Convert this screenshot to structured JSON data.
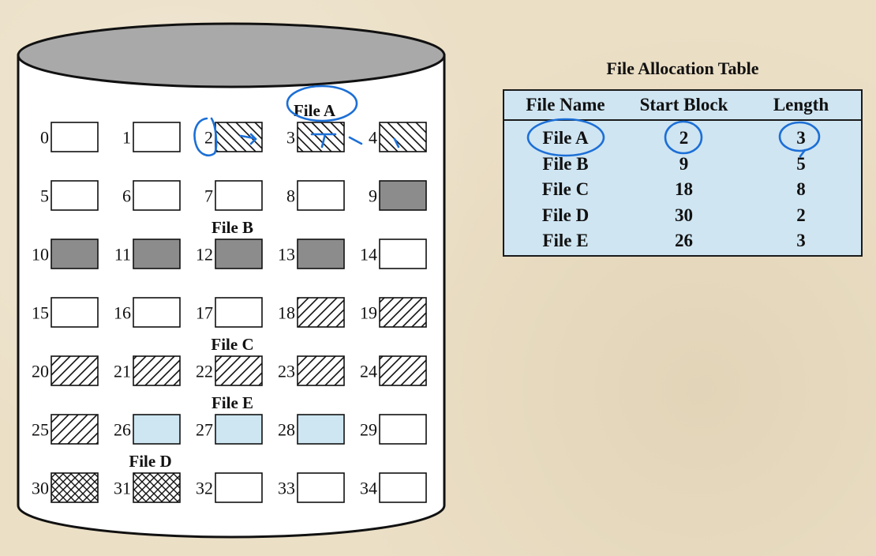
{
  "disk": {
    "blocks": [
      {
        "n": "0",
        "fill": "empty"
      },
      {
        "n": "1",
        "fill": "empty"
      },
      {
        "n": "2",
        "fill": "backhatch"
      },
      {
        "n": "3",
        "fill": "backhatch"
      },
      {
        "n": "4",
        "fill": "backhatch"
      },
      {
        "n": "5",
        "fill": "empty"
      },
      {
        "n": "6",
        "fill": "empty"
      },
      {
        "n": "7",
        "fill": "empty"
      },
      {
        "n": "8",
        "fill": "empty"
      },
      {
        "n": "9",
        "fill": "gray"
      },
      {
        "n": "10",
        "fill": "gray"
      },
      {
        "n": "11",
        "fill": "gray"
      },
      {
        "n": "12",
        "fill": "gray"
      },
      {
        "n": "13",
        "fill": "gray"
      },
      {
        "n": "14",
        "fill": "empty"
      },
      {
        "n": "15",
        "fill": "empty"
      },
      {
        "n": "16",
        "fill": "empty"
      },
      {
        "n": "17",
        "fill": "empty"
      },
      {
        "n": "18",
        "fill": "hatch"
      },
      {
        "n": "19",
        "fill": "hatch"
      },
      {
        "n": "20",
        "fill": "hatch"
      },
      {
        "n": "21",
        "fill": "hatch"
      },
      {
        "n": "22",
        "fill": "hatch"
      },
      {
        "n": "23",
        "fill": "hatch"
      },
      {
        "n": "24",
        "fill": "hatch"
      },
      {
        "n": "25",
        "fill": "hatch"
      },
      {
        "n": "26",
        "fill": "blue"
      },
      {
        "n": "27",
        "fill": "blue"
      },
      {
        "n": "28",
        "fill": "blue"
      },
      {
        "n": "29",
        "fill": "empty"
      },
      {
        "n": "30",
        "fill": "cross"
      },
      {
        "n": "31",
        "fill": "cross"
      },
      {
        "n": "32",
        "fill": "empty"
      },
      {
        "n": "33",
        "fill": "empty"
      },
      {
        "n": "34",
        "fill": "empty"
      }
    ],
    "file_labels": [
      {
        "text": "File A",
        "row": 0,
        "col": 3
      },
      {
        "text": "File B",
        "row": 2,
        "col": 2
      },
      {
        "text": "File C",
        "row": 4,
        "col": 2
      },
      {
        "text": "File E",
        "row": 5,
        "col": 2
      },
      {
        "text": "File D",
        "row": 6,
        "col": 1
      }
    ]
  },
  "fat": {
    "title": "File Allocation Table",
    "headers": [
      "File Name",
      "Start Block",
      "Length"
    ],
    "rows": [
      [
        "File A",
        "2",
        "3"
      ],
      [
        "File B",
        "9",
        "5"
      ],
      [
        "File C",
        "18",
        "8"
      ],
      [
        "File D",
        "30",
        "2"
      ],
      [
        "File E",
        "26",
        "3"
      ]
    ]
  },
  "colors": {
    "background": "#ebdfc6",
    "disk_top": "#a9a9a9",
    "gray_block": "#8c8c8c",
    "blue_block": "#cde6f2",
    "table_bg": "#cfe5f2",
    "ink": "#1c6fd6"
  }
}
